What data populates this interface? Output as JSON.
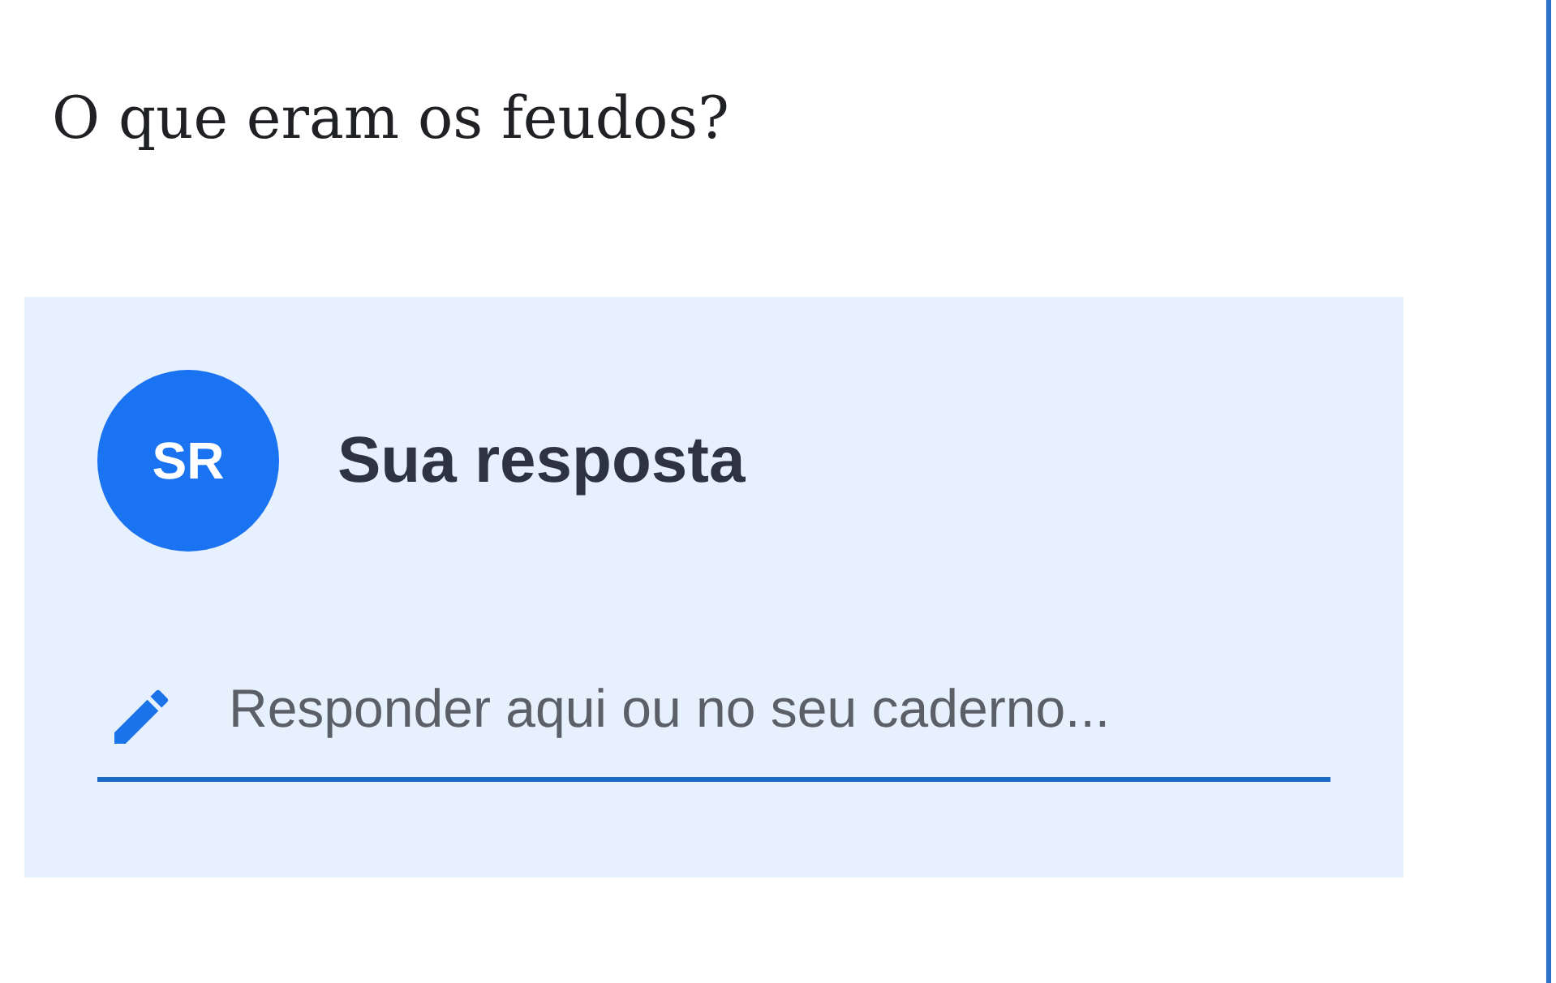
{
  "question": "O que eram os feudos?",
  "answer_card": {
    "avatar_initials": "SR",
    "title": "Sua resposta",
    "field": {
      "placeholder": "Responder aqui ou no seu caderno..."
    }
  }
}
